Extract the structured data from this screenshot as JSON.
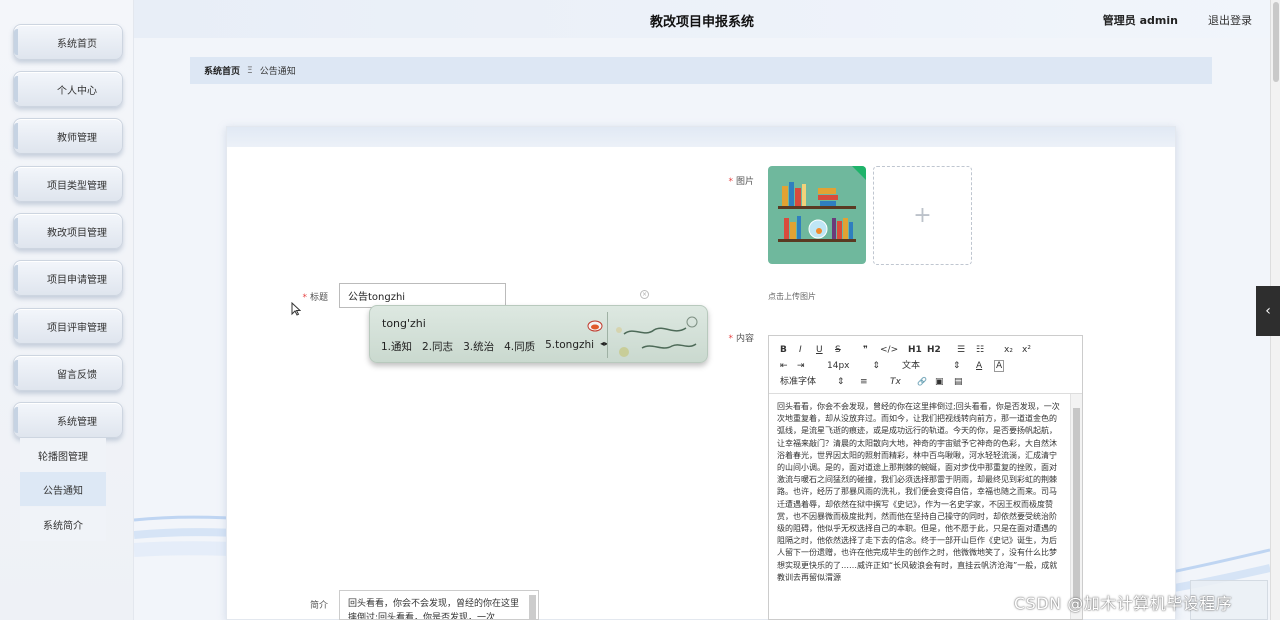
{
  "header": {
    "title": "教改项目申报系统",
    "user": "管理员 admin",
    "logout": "退出登录"
  },
  "sidebar": {
    "items": [
      {
        "label": "系统首页"
      },
      {
        "label": "个人中心"
      },
      {
        "label": "教师管理"
      },
      {
        "label": "项目类型管理"
      },
      {
        "label": "教改项目管理"
      },
      {
        "label": "项目申请管理"
      },
      {
        "label": "项目评审管理"
      },
      {
        "label": "留言反馈"
      },
      {
        "label": "系统管理"
      }
    ],
    "subitems": [
      {
        "label": "轮播图管理",
        "active": false
      },
      {
        "label": "公告通知",
        "active": true
      },
      {
        "label": "系统简介",
        "active": false
      }
    ]
  },
  "breadcrumb": {
    "home": "系统首页",
    "separator": "Ξ",
    "current": "公告通知"
  },
  "form": {
    "title_label": "标题",
    "title_value": "公告tongzhi",
    "image_label": "图片",
    "upload_hint": "点击上传图片",
    "upload_plus": "+",
    "content_label": "内容",
    "intro_label": "简介",
    "intro_value": "回头看看，你会不会发现，曾经的你在这里摔倒过;回头看看，你是否发现，一次"
  },
  "editor": {
    "toolbar": {
      "bold": "B",
      "italic": "I",
      "underline": "U",
      "strike": "S",
      "quote": "❞",
      "code": "</>",
      "h1": "H1",
      "h2": "H2",
      "ol": "☰",
      "ul": "☷",
      "sub": "x₂",
      "sup": "x²",
      "indent_left": "⇤",
      "indent_right": "⇥",
      "size": "14px",
      "format": "文本",
      "font": "标准字体",
      "color": "A",
      "bg": "A",
      "align": "≡",
      "clear": "Tx",
      "link": "🔗",
      "image": "▣",
      "video": "▤"
    },
    "content": "回头看看，你会不会发现，曾经的你在这里摔倒过;回头看看，你是否发现，一次次地重复着，却从没放弃过。而如今，让我们把视线转向前方，那一道道金色的弧线，是流星飞逝的痕迹，或是成功远行的轨道。今天的你，是否要扬帆起航，让幸福来敲门？清晨的太阳散向大地，神奇的宇宙赋予它神奇的色彩，大自然沐浴着春光，世界因太阳的照射而精彩，林中百鸟啾啾，河水轻轻流淌，汇成清宁的山间小调。是的，面对道途上那荆棘的蜿蜒，面对步伐中那重复的挫败，面对激流与暖石之间猛烈的碰撞，我们必须选择那雷于阴雨，却最终见到彩虹的荆棘路。也许，经历了那暴风雨的洗礼，我们便会变得自信，幸福也随之而来。司马迁遭遇着辱，却依然在狱中撰写《史记》，作为一名史学家，不因王权而极度赞赏，也不因暴微而极度批判，然而他在坚持自己操守的同时，却依然要受统治阶级的阻碍，他似乎无权选择自己的本职。但是，他不愿于此，只是在面对遭遇的阻隔之时，他依然选择了走下去的信念。终于一部开山巨作《史记》诞生，为后人留下一份遗赠，也许在他完成毕生的创作之时，他微微地笑了，没有什么比梦想实现更快乐的了……威许正如“长风破浪会有时，直挂云帆济沧海”一般，成就教训去再留似渭源"
  },
  "ime": {
    "pinyin": "tong'zhi",
    "candidates": [
      "1.通知",
      "2.同志",
      "3.统治",
      "4.同质",
      "5.tongzhi"
    ]
  },
  "watermark": "CSDN @加木计算机毕设程序",
  "colors": {
    "accent": "#dde7f4",
    "required": "#e64545",
    "image_bg": "#6fb89d"
  }
}
